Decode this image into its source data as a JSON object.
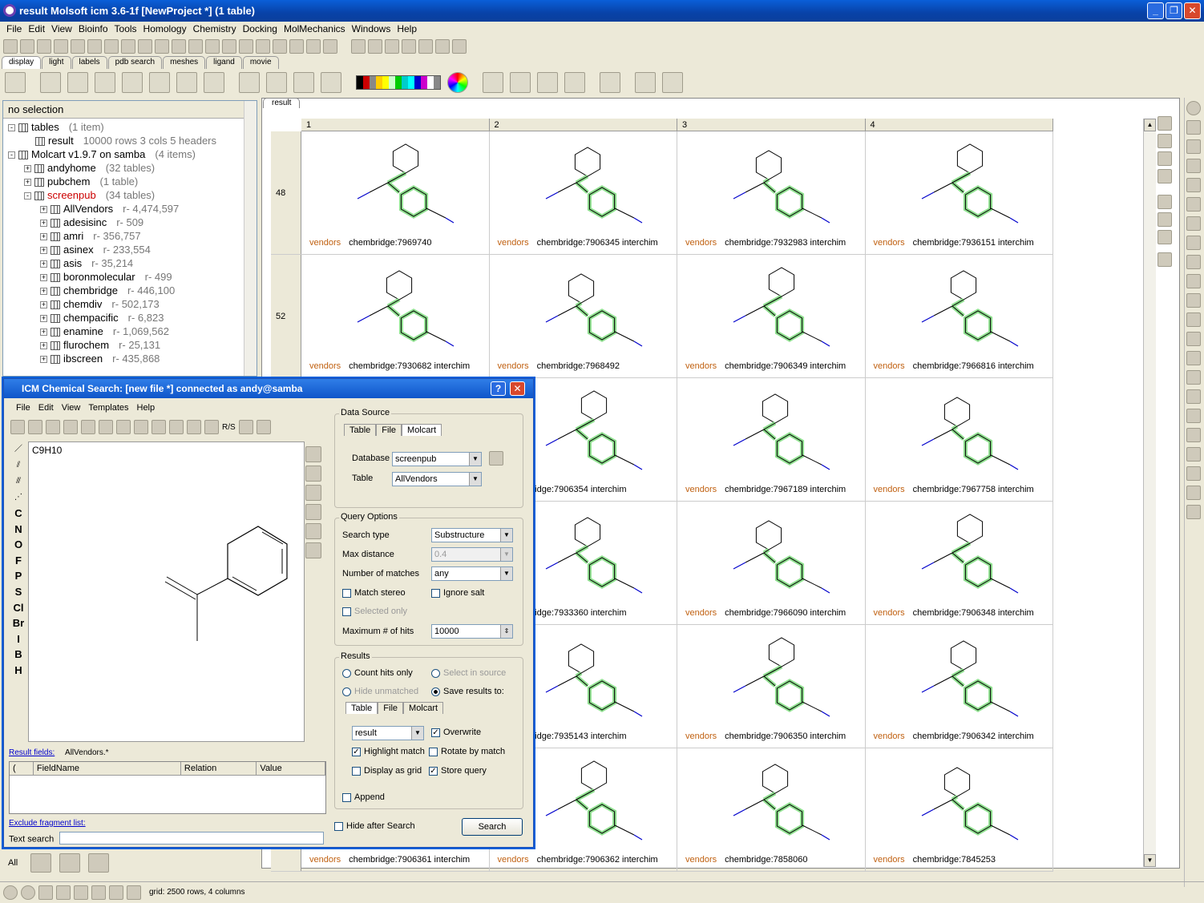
{
  "window": {
    "title": "result Molsoft icm 3.6-1f  [NewProject *] (1 table)"
  },
  "menu": [
    "File",
    "Edit",
    "View",
    "Bioinfo",
    "Tools",
    "Homology",
    "Chemistry",
    "Docking",
    "MolMechanics",
    "Windows",
    "Help"
  ],
  "tabs": [
    "display",
    "light",
    "labels",
    "pdb search",
    "meshes",
    "ligand",
    "movie"
  ],
  "left_panel": {
    "header": "no selection",
    "tree": [
      {
        "label": "tables",
        "extra": "(1 item)",
        "indent": 0,
        "box": "-"
      },
      {
        "label": "result",
        "extra": "10000 rows 3 cols 5 headers",
        "indent": 1
      },
      {
        "label": "Molcart v1.9.7 on samba",
        "extra": "(4 items)",
        "indent": 0,
        "box": "-"
      },
      {
        "label": "andyhome",
        "extra": "(32 tables)",
        "indent": 1,
        "box": "+"
      },
      {
        "label": "pubchem",
        "extra": "(1 table)",
        "indent": 1,
        "box": "+"
      },
      {
        "label": "screenpub",
        "extra": "(34 tables)",
        "indent": 1,
        "box": "-",
        "red": true
      },
      {
        "label": "AllVendors",
        "extra": "r- 4,474,597",
        "indent": 2,
        "box": "+"
      },
      {
        "label": "adesisinc",
        "extra": "r- 509",
        "indent": 2,
        "box": "+"
      },
      {
        "label": "amri",
        "extra": "r- 356,757",
        "indent": 2,
        "box": "+"
      },
      {
        "label": "asinex",
        "extra": "r- 233,554",
        "indent": 2,
        "box": "+"
      },
      {
        "label": "asis",
        "extra": "r- 35,214",
        "indent": 2,
        "box": "+"
      },
      {
        "label": "boronmolecular",
        "extra": "r- 499",
        "indent": 2,
        "box": "+"
      },
      {
        "label": "chembridge",
        "extra": "r- 446,100",
        "indent": 2,
        "box": "+"
      },
      {
        "label": "chemdiv",
        "extra": "r- 502,173",
        "indent": 2,
        "box": "+"
      },
      {
        "label": "chempacific",
        "extra": "r- 6,823",
        "indent": 2,
        "box": "+"
      },
      {
        "label": "enamine",
        "extra": "r- 1,069,562",
        "indent": 2,
        "box": "+"
      },
      {
        "label": "flurochem",
        "extra": "r- 25,131",
        "indent": 2,
        "box": "+"
      },
      {
        "label": "ibscreen",
        "extra": "r- 435,868",
        "indent": 2,
        "box": "+"
      }
    ]
  },
  "grid": {
    "tab": "result",
    "columns": [
      "1",
      "2",
      "3",
      "4"
    ],
    "rows": [
      {
        "num": "48",
        "cells": [
          {
            "vend": "vendors",
            "id": "chembridge:7969740"
          },
          {
            "vend": "vendors",
            "id": "chembridge:7906345 interchim"
          },
          {
            "vend": "vendors",
            "id": "chembridge:7932983 interchim"
          },
          {
            "vend": "vendors",
            "id": "chembridge:7936151 interchim"
          }
        ]
      },
      {
        "num": "52",
        "cells": [
          {
            "vend": "vendors",
            "id": "chembridge:7930682 interchim"
          },
          {
            "vend": "vendors",
            "id": "chembridge:7968492"
          },
          {
            "vend": "vendors",
            "id": "chembridge:7906349 interchim"
          },
          {
            "vend": "vendors",
            "id": "chembridge:7966816 interchim"
          }
        ]
      },
      {
        "num": "",
        "cells": [
          {
            "vend": "",
            "id": ""
          },
          {
            "vend": "",
            "id": "chembridge:7906354 interchim"
          },
          {
            "vend": "vendors",
            "id": "chembridge:7967189 interchim"
          },
          {
            "vend": "vendors",
            "id": "chembridge:7967758 interchim"
          }
        ]
      },
      {
        "num": "",
        "cells": [
          {
            "vend": "",
            "id": ""
          },
          {
            "vend": "",
            "id": "chembridge:7933360 interchim"
          },
          {
            "vend": "vendors",
            "id": "chembridge:7966090 interchim"
          },
          {
            "vend": "vendors",
            "id": "chembridge:7906348 interchim"
          }
        ]
      },
      {
        "num": "",
        "cells": [
          {
            "vend": "",
            "id": ""
          },
          {
            "vend": "",
            "id": "chembridge:7935143 interchim"
          },
          {
            "vend": "vendors",
            "id": "chembridge:7906350 interchim"
          },
          {
            "vend": "vendors",
            "id": "chembridge:7906342 interchim"
          }
        ]
      },
      {
        "num": "",
        "cells": [
          {
            "vend": "vendors",
            "id": "chembridge:7906361 interchim"
          },
          {
            "vend": "vendors",
            "id": "chembridge:7906362 interchim"
          },
          {
            "vend": "vendors",
            "id": "chembridge:7858060"
          },
          {
            "vend": "vendors",
            "id": "chembridge:7845253"
          }
        ]
      }
    ]
  },
  "dialog": {
    "title": "ICM Chemical Search: [new file *] connected as andy@samba",
    "menu": [
      "File",
      "Edit",
      "View",
      "Templates",
      "Help"
    ],
    "rs_label": "R/S",
    "formula": "C9H10",
    "atoms": [
      "C",
      "N",
      "O",
      "F",
      "P",
      "S",
      "Cl",
      "Br",
      "I",
      "B",
      "H"
    ],
    "result_fields_link": "Result fields:",
    "result_fields_value": "AllVendors.*",
    "field_headers": [
      "(",
      "FieldName",
      "Relation",
      "Value"
    ],
    "exclude_link": "Exclude fragment list:",
    "text_search_label": "Text search",
    "data_source": {
      "title": "Data Source",
      "tabs": [
        "Table",
        "File",
        "Molcart"
      ],
      "database_label": "Database",
      "database_value": "screenpub",
      "table_label": "Table",
      "table_value": "AllVendors"
    },
    "query": {
      "title": "Query Options",
      "search_type_label": "Search type",
      "search_type_value": "Substructure",
      "max_distance_label": "Max distance",
      "max_distance_value": "0.4",
      "matches_label": "Number of matches",
      "matches_value": "any",
      "match_stereo": "Match stereo",
      "ignore_salt": "Ignore salt",
      "selected_only": "Selected only",
      "max_hits_label": "Maximum # of hits",
      "max_hits_value": "10000"
    },
    "results": {
      "title": "Results",
      "count_hits": "Count hits only",
      "select_source": "Select in source",
      "hide_unmatched": "Hide unmatched",
      "save_results": "Save results to:",
      "tabs": [
        "Table",
        "File",
        "Molcart"
      ],
      "result_value": "result",
      "overwrite": "Overwrite",
      "highlight": "Highlight match",
      "rotate": "Rotate by match",
      "display_grid": "Display as grid",
      "store_query": "Store query",
      "append": "Append"
    },
    "hide_after": "Hide after Search",
    "search_button": "Search"
  },
  "bottom_tab_all": "All",
  "status": {
    "text": "grid: 2500 rows, 4 columns"
  }
}
